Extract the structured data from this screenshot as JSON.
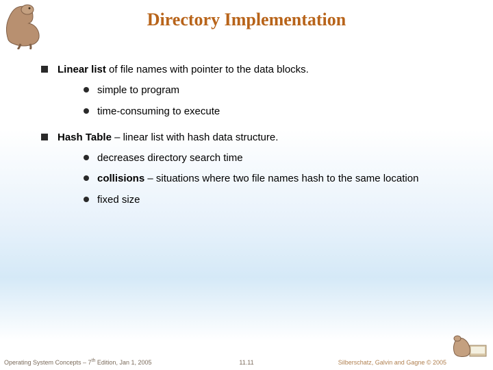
{
  "title": "Directory Implementation",
  "bullets": {
    "item1": {
      "bold": "Linear list",
      "rest": " of file names with pointer to the data blocks."
    },
    "item1_sub": {
      "a": "simple to program",
      "b": "time-consuming to execute"
    },
    "item2": {
      "bold": "Hash Table",
      "rest": " – linear list with hash data structure."
    },
    "item2_sub": {
      "a": "decreases directory search time",
      "b_bold": "collisions",
      "b_rest": " – situations where two file names hash to the same location",
      "c": "fixed size"
    }
  },
  "footer": {
    "left_pre": "Operating System Concepts – 7",
    "left_sup": "th",
    "left_post": " Edition, Jan 1, 2005",
    "center": "11.11",
    "right": "Silberschatz, Galvin and Gagne © 2005"
  }
}
